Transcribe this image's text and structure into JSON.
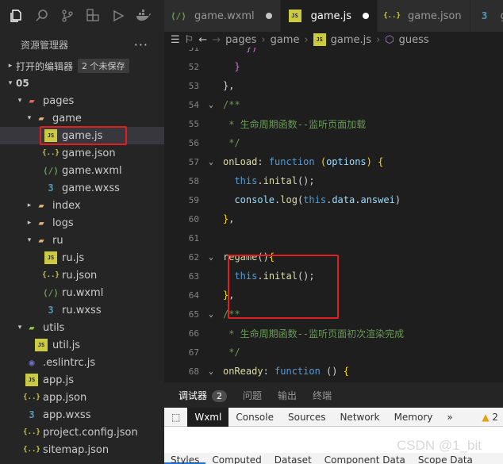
{
  "sidebar": {
    "title": "资源管理器",
    "open_editors": {
      "label": "打开的编辑器",
      "badge": "2 个未保存"
    },
    "root": "05",
    "tree": [
      {
        "label": "pages",
        "indent": 1,
        "icon": "folder-red",
        "chev": "▾"
      },
      {
        "label": "game",
        "indent": 2,
        "icon": "folder",
        "chev": "▾"
      },
      {
        "label": "game.js",
        "indent": 3,
        "icon": "js",
        "selected": true
      },
      {
        "label": "game.json",
        "indent": 3,
        "icon": "json"
      },
      {
        "label": "game.wxml",
        "indent": 3,
        "icon": "wxml"
      },
      {
        "label": "game.wxss",
        "indent": 3,
        "icon": "wxss"
      },
      {
        "label": "index",
        "indent": 2,
        "icon": "folder",
        "chev": "▸"
      },
      {
        "label": "logs",
        "indent": 2,
        "icon": "folder",
        "chev": "▸"
      },
      {
        "label": "ru",
        "indent": 2,
        "icon": "folder",
        "chev": "▾"
      },
      {
        "label": "ru.js",
        "indent": 3,
        "icon": "js"
      },
      {
        "label": "ru.json",
        "indent": 3,
        "icon": "json"
      },
      {
        "label": "ru.wxml",
        "indent": 3,
        "icon": "wxml"
      },
      {
        "label": "ru.wxss",
        "indent": 3,
        "icon": "wxss"
      },
      {
        "label": "utils",
        "indent": 1,
        "icon": "folder-green",
        "chev": "▾"
      },
      {
        "label": "util.js",
        "indent": 2,
        "icon": "js"
      },
      {
        "label": ".eslintrc.js",
        "indent": 1,
        "icon": "eslint"
      },
      {
        "label": "app.js",
        "indent": 1,
        "icon": "js"
      },
      {
        "label": "app.json",
        "indent": 1,
        "icon": "json"
      },
      {
        "label": "app.wxss",
        "indent": 1,
        "icon": "wxss"
      },
      {
        "label": "project.config.json",
        "indent": 1,
        "icon": "json"
      },
      {
        "label": "sitemap.json",
        "indent": 1,
        "icon": "json"
      }
    ]
  },
  "tabs": [
    {
      "label": "game.wxml",
      "icon": "wxml",
      "dirty": true,
      "active": false
    },
    {
      "label": "game.js",
      "icon": "js",
      "dirty": true,
      "active": true
    },
    {
      "label": "game.json",
      "icon": "json",
      "dirty": false,
      "active": false
    },
    {
      "label": "game",
      "icon": "wxss",
      "dirty": false,
      "active": false
    }
  ],
  "breadcrumb": [
    "pages",
    "game",
    "game.js",
    "guess"
  ],
  "editor": {
    "lines": [
      {
        "n": "51",
        "html": "    <span class=\"tok-purple\">})</span>"
      },
      {
        "n": "52",
        "html": "  <span class=\"tok-purple\">}</span>"
      },
      {
        "n": "53",
        "html": "},"
      },
      {
        "n": "54",
        "fold": "⌄",
        "html": "<span class=\"tok-com\">/**</span>"
      },
      {
        "n": "55",
        "html": "<span class=\"tok-com\"> * 生命周期函数--监听页面加载</span>"
      },
      {
        "n": "56",
        "html": "<span class=\"tok-com\"> */</span>"
      },
      {
        "n": "57",
        "fold": "⌄",
        "html": "<span class=\"tok-fn\">onLoad</span>: <span class=\"tok-kw\">function</span> <span class=\"tok-punc\">(</span><span class=\"tok-prop\">options</span><span class=\"tok-punc\">)</span> <span class=\"tok-punc\">{</span>"
      },
      {
        "n": "58",
        "html": "  <span class=\"tok-kw\">this</span>.<span class=\"tok-fn\">inital</span>();"
      },
      {
        "n": "59",
        "html": "  <span class=\"tok-prop\">console</span>.<span class=\"tok-fn\">log</span>(<span class=\"tok-kw\">this</span>.<span class=\"tok-prop\">data</span>.<span class=\"tok-prop\">answei</span>)"
      },
      {
        "n": "60",
        "html": "<span class=\"tok-punc\">}</span>,"
      },
      {
        "n": "61",
        "html": ""
      },
      {
        "n": "62",
        "fold": "⌄",
        "html": "<span class=\"tok-fn\">regame</span>()<span class=\"tok-punc\">{</span>"
      },
      {
        "n": "63",
        "html": "  <span class=\"tok-kw\">this</span>.<span class=\"tok-fn\">inital</span>();"
      },
      {
        "n": "64",
        "html": "<span class=\"tok-punc\">}</span>,"
      },
      {
        "n": "65",
        "fold": "⌄",
        "html": "<span class=\"tok-com\">/**</span>"
      },
      {
        "n": "66",
        "html": "<span class=\"tok-com\"> * 生命周期函数--监听页面初次渲染完成</span>"
      },
      {
        "n": "67",
        "html": "<span class=\"tok-com\"> */</span>"
      },
      {
        "n": "68",
        "fold": "⌄",
        "html": "<span class=\"tok-fn\">onReady</span>: <span class=\"tok-kw\">function</span> () <span class=\"tok-punc\">{</span>"
      }
    ]
  },
  "panel": {
    "tabs": [
      {
        "label": "调试器",
        "active": true,
        "badge": "2"
      },
      {
        "label": "问题"
      },
      {
        "label": "输出"
      },
      {
        "label": "终端"
      }
    ]
  },
  "devtools": {
    "tabs": [
      "Wxml",
      "Console",
      "Sources",
      "Network",
      "Memory"
    ],
    "active": "Wxml",
    "more": "»",
    "warnings": "2"
  },
  "styles_tabs": [
    "Styles",
    "Computed",
    "Dataset",
    "Component Data",
    "Scope Data"
  ],
  "watermark": "CSDN @1_bit"
}
